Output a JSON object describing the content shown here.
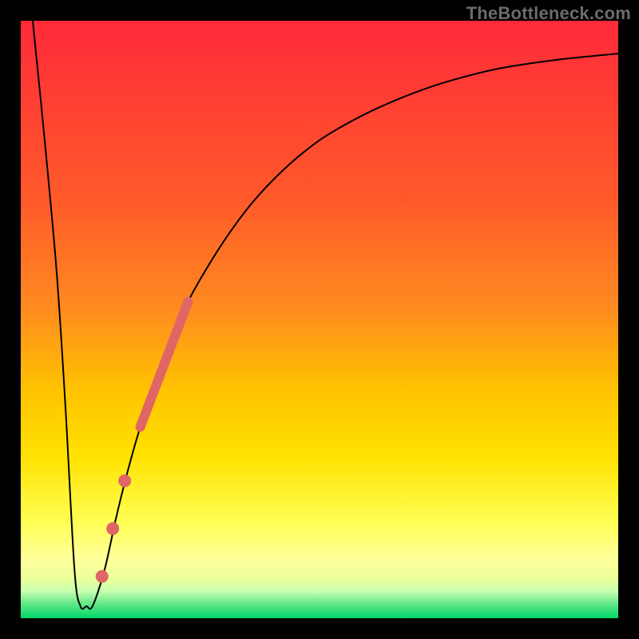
{
  "watermark": "TheBottleneck.com",
  "colors": {
    "frame": "#000000",
    "curve": "#000000",
    "dots": "#e06666",
    "gradient_top": "#ff2a3a",
    "gradient_mid_upper": "#ff8a1f",
    "gradient_mid": "#ffe200",
    "gradient_pale": "#ffff9a",
    "gradient_band": "#c6ffb0",
    "gradient_bottom": "#00d76a"
  },
  "chart_data": {
    "type": "line",
    "title": "",
    "xlabel": "",
    "ylabel": "",
    "xlim": [
      0,
      100
    ],
    "ylim": [
      0,
      100
    ],
    "series": [
      {
        "name": "bottleneck-curve",
        "x": [
          2,
          4,
          6,
          7.5,
          9,
          10,
          11,
          12,
          14,
          16,
          18,
          20,
          22,
          25,
          28,
          32,
          36,
          40,
          45,
          50,
          55,
          60,
          66,
          72,
          80,
          90,
          100
        ],
        "y": [
          100,
          80,
          58,
          35,
          8,
          2,
          2,
          2,
          8,
          17,
          25,
          32,
          38,
          46,
          53,
          60,
          66,
          71,
          76,
          80,
          83,
          85.5,
          88,
          90,
          92,
          93.5,
          94.5
        ]
      }
    ],
    "markers": [
      {
        "name": "highlight-streak",
        "shape": "rounded-line",
        "x0": 20,
        "y0": 32,
        "x1": 28,
        "y1": 53,
        "width": 12
      },
      {
        "name": "dot-1",
        "shape": "circle",
        "x": 17.4,
        "y": 23,
        "r": 8
      },
      {
        "name": "dot-2",
        "shape": "circle",
        "x": 15.4,
        "y": 15,
        "r": 8
      },
      {
        "name": "dot-3",
        "shape": "circle",
        "x": 13.6,
        "y": 7,
        "r": 8
      }
    ]
  }
}
